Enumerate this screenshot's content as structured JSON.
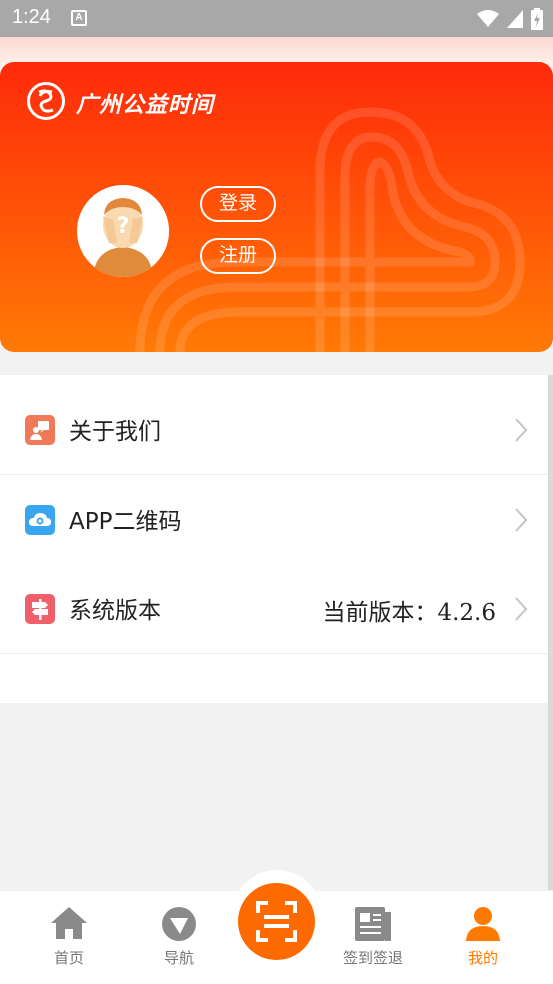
{
  "status_bar": {
    "time": "1:24",
    "notification_glyph": "A"
  },
  "header": {
    "app_title": "广州公益时间",
    "login_label": "登录",
    "register_label": "注册"
  },
  "menu": {
    "items": [
      {
        "label": "关于我们",
        "icon": "about-icon",
        "color": "#f07a58"
      },
      {
        "label": "APP二维码",
        "icon": "cloud-qr-icon",
        "color": "#3aa6f0"
      },
      {
        "label": "系统版本",
        "icon": "signpost-icon",
        "color": "#f0606a",
        "value": "当前版本：4.2.6"
      }
    ]
  },
  "bottom_nav": {
    "items": [
      {
        "label": "首页",
        "icon": "home-icon",
        "active": false
      },
      {
        "label": "导航",
        "icon": "navigation-icon",
        "active": false
      },
      {
        "label": "签到签退",
        "icon": "checkin-icon",
        "active": false
      },
      {
        "label": "我的",
        "icon": "profile-icon",
        "active": true
      }
    ],
    "center_icon": "scan-icon"
  },
  "colors": {
    "accent": "#ff6a00",
    "header_top": "#ff2a0a",
    "header_bottom": "#ff7a06"
  }
}
